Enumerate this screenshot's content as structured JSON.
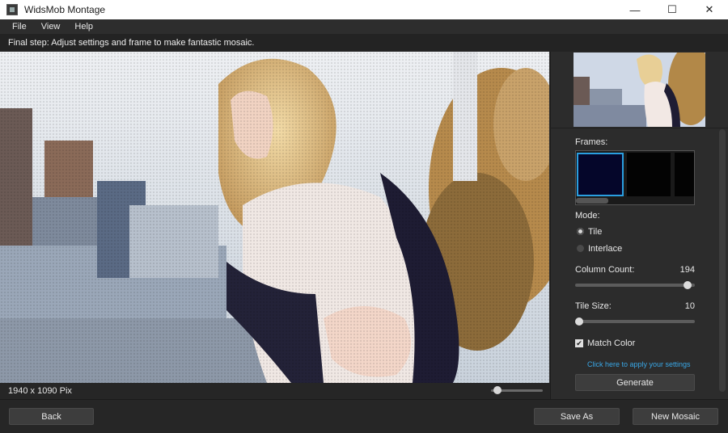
{
  "window": {
    "title": "WidsMob Montage"
  },
  "controls": {
    "minimize": "—",
    "maximize": "☐",
    "close": "✕"
  },
  "menu": [
    "File",
    "View",
    "Help"
  ],
  "instruction": "Final step: Adjust settings and frame to make fantastic mosaic.",
  "status": {
    "dimensions": "1940 x 1090 Pix",
    "zoom_level": 0.05
  },
  "sidebar": {
    "frames_label": "Frames:",
    "mode_label": "Mode:",
    "modes": [
      {
        "label": "Tile",
        "selected": true
      },
      {
        "label": "Interlace",
        "selected": false
      }
    ],
    "column_count": {
      "label": "Column Count:",
      "value": "194",
      "fraction": 0.97
    },
    "tile_size": {
      "label": "Tile Size:",
      "value": "10",
      "fraction": 0.0
    },
    "match_color": {
      "label": "Match Color",
      "checked": true,
      "mark": "✔"
    },
    "apply_link": "Click here to apply your settings",
    "generate_label": "Generate"
  },
  "footer": {
    "back_label": "Back",
    "save_as_label": "Save As",
    "new_mosaic_label": "New Mosaic"
  },
  "colors": {
    "accent": "#2a9fe0",
    "link": "#39a7e6",
    "panel": "#2c2c2c"
  }
}
